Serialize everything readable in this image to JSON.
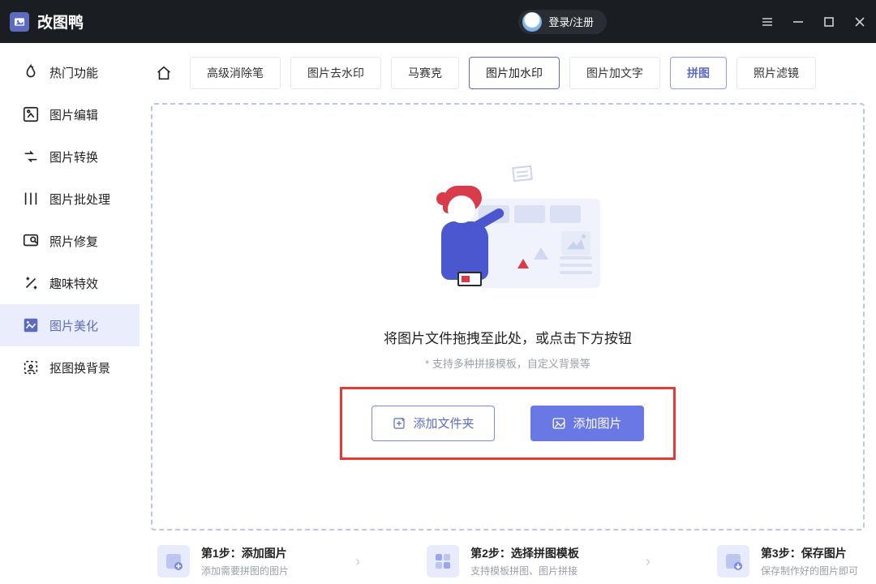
{
  "titlebar": {
    "app_name": "改图鸭",
    "login_label": "登录/注册"
  },
  "sidebar": {
    "items": [
      {
        "label": "热门功能"
      },
      {
        "label": "图片编辑"
      },
      {
        "label": "图片转换"
      },
      {
        "label": "图片批处理"
      },
      {
        "label": "照片修复"
      },
      {
        "label": "趣味特效"
      },
      {
        "label": "图片美化"
      },
      {
        "label": "抠图换背景"
      }
    ],
    "active_index": 6
  },
  "tabs": {
    "items": [
      {
        "label": "高级消除笔"
      },
      {
        "label": "图片去水印"
      },
      {
        "label": "马赛克"
      },
      {
        "label": "图片加水印"
      },
      {
        "label": "图片加文字"
      },
      {
        "label": "拼图"
      },
      {
        "label": "照片滤镜"
      }
    ],
    "selected_index": 3,
    "pinned_index": 5
  },
  "dropzone": {
    "title": "将图片文件拖拽至此处，或点击下方按钮",
    "subtitle": "* 支持多种拼接模板，自定义背景等",
    "add_folder_label": "添加文件夹",
    "add_image_label": "添加图片"
  },
  "steps": [
    {
      "title": "第1步：添加图片",
      "subtitle": "添加需要拼图的图片"
    },
    {
      "title": "第2步：选择拼图模板",
      "subtitle": "支持模板拼图、图片拼接"
    },
    {
      "title": "第3步：保存图片",
      "subtitle": "保存制作好的图片即可"
    }
  ]
}
